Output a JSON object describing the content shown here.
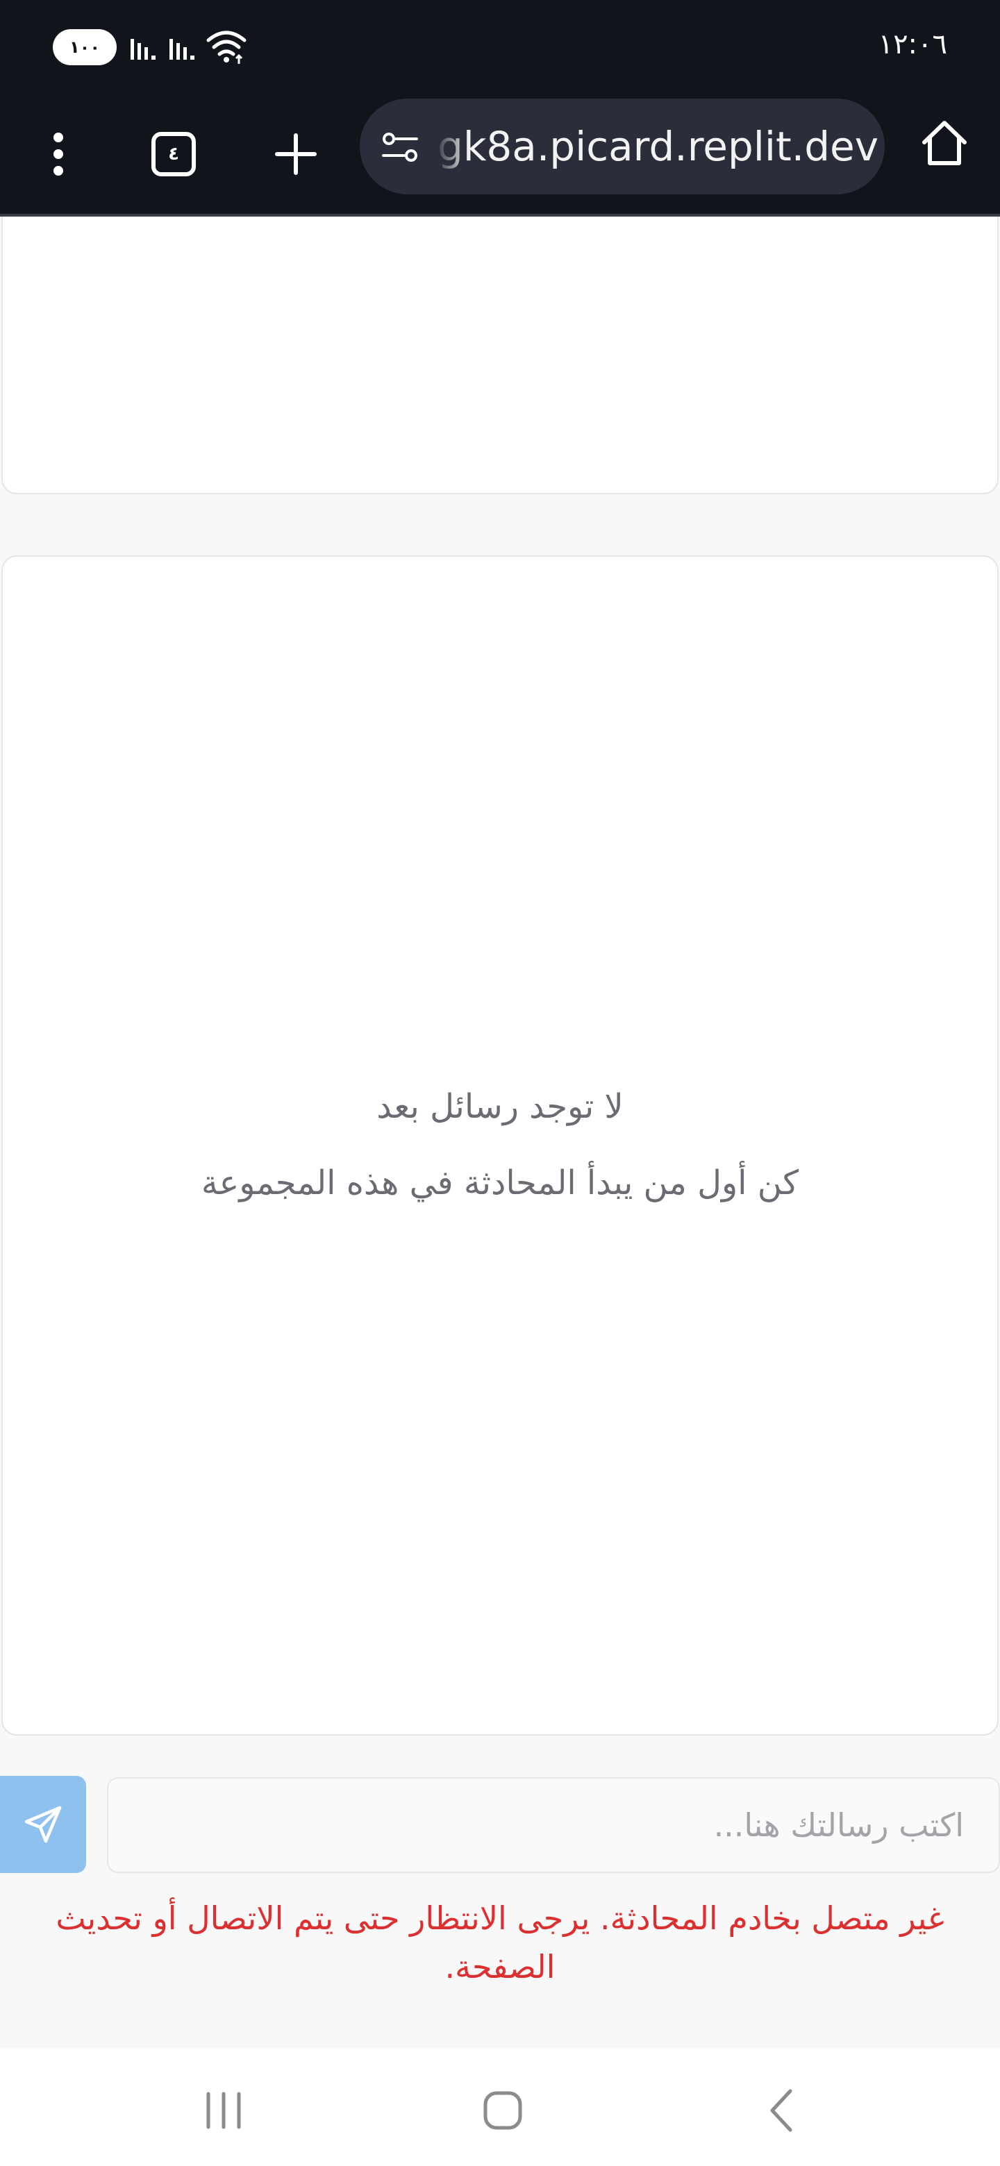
{
  "status_bar": {
    "battery": "١٠٠",
    "time": "١٢:٠٦"
  },
  "browser": {
    "url": "gk8a.picard.replit.dev",
    "tab_count": "٤"
  },
  "chat": {
    "empty_title": "لا توجد رسائل بعد",
    "empty_subtitle": "كن أول من يبدأ المحادثة في هذه المجموعة"
  },
  "composer": {
    "placeholder": "اكتب رسالتك هنا...",
    "value": "",
    "send_icon": "send-icon"
  },
  "error": {
    "message": "غير متصل بخادم المحادثة. يرجى الانتظار حتى يتم الاتصال أو تحديث الصفحة."
  },
  "colors": {
    "toolbar_bg": "#12141c",
    "send_button": "#8fc1ee",
    "error": "#dc2f2f",
    "muted_text": "#6b6b73"
  }
}
